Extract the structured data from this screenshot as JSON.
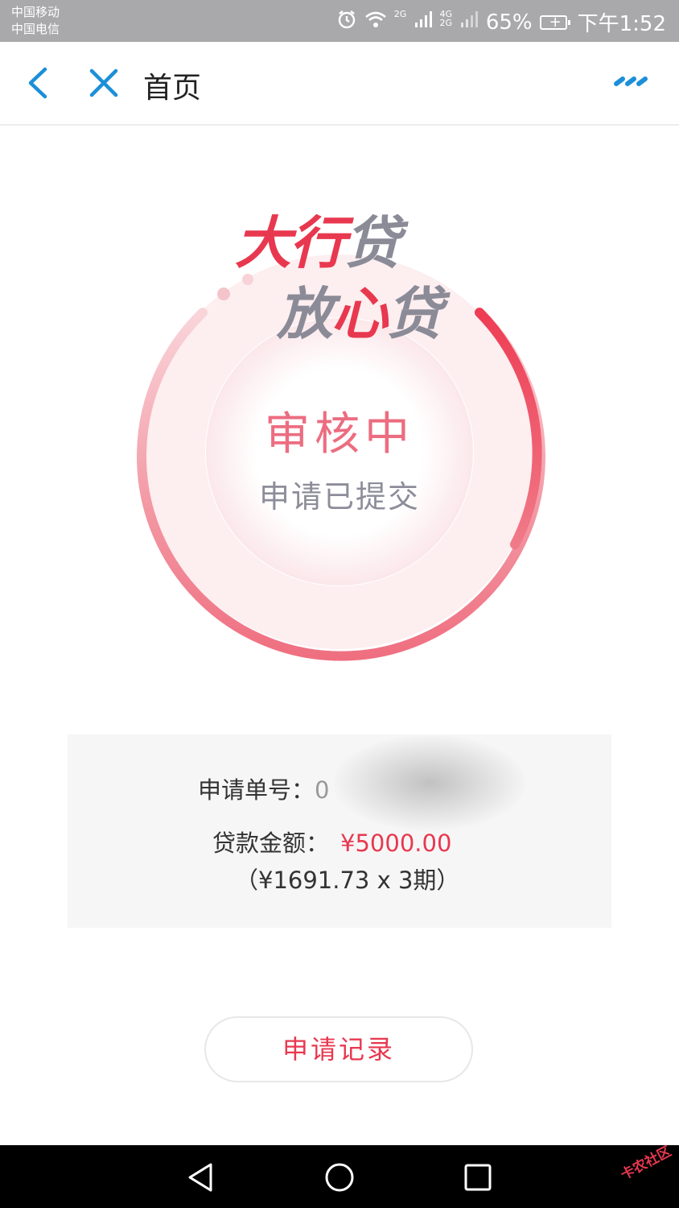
{
  "status_bar": {
    "carrier_1": "中国移动",
    "carrier_2": "中国电信",
    "signal_1_label": "2G",
    "signal_2_label": "4G 2G",
    "battery": "65%",
    "time": "下午1:52"
  },
  "nav": {
    "title": "首页",
    "back_icon": "chevron-left-icon",
    "close_icon": "close-icon",
    "more_icon": "more-dots-icon",
    "accent_color": "#1c8fd8"
  },
  "hero": {
    "logo_line1_a": "大行",
    "logo_line1_b": "贷",
    "logo_line2_a": "放",
    "logo_line2_b": "心",
    "logo_line2_c": "贷",
    "status_title": "审核中",
    "status_subtitle": "申请已提交",
    "accent_color": "#e8384f"
  },
  "info": {
    "order_label": "申请单号：",
    "order_value_visible": "0",
    "amount_label": "贷款金额：",
    "amount_value": "¥5000.00",
    "installment": "（¥1691.73 x 3期）"
  },
  "actions": {
    "record_button": "申请记录"
  },
  "system_nav": {
    "back_icon": "triangle-back-icon",
    "home_icon": "circle-home-icon",
    "recent_icon": "square-recent-icon",
    "watermark": "卡农社区"
  }
}
